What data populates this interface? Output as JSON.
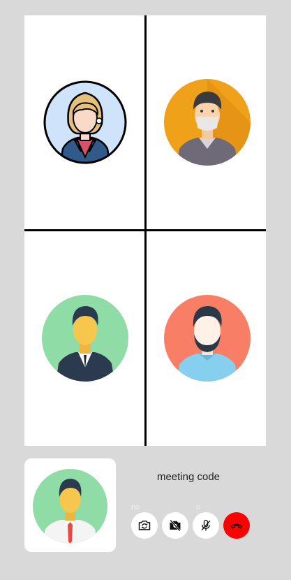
{
  "participants": [
    {
      "id": "participant-1",
      "avatar": "woman-blonde-avatar",
      "bg": "#cfe3fb"
    },
    {
      "id": "participant-2",
      "avatar": "man-mask-avatar",
      "bg": "#f0a11a"
    },
    {
      "id": "participant-3",
      "avatar": "man-suit-avatar",
      "bg": "#8fdca7"
    },
    {
      "id": "participant-4",
      "avatar": "man-beard-avatar",
      "bg": "#f87f66"
    }
  ],
  "self_view": {
    "avatar": "man-red-tie-avatar",
    "bg": "#8fdca7"
  },
  "meeting": {
    "code_label": "meeting code"
  },
  "ghost_labels": {
    "left": "no",
    "right": "o"
  },
  "controls": [
    {
      "name": "switch-camera-button",
      "icon": "camera-flip-icon"
    },
    {
      "name": "video-off-button",
      "icon": "video-off-icon"
    },
    {
      "name": "mute-button",
      "icon": "mic-off-icon"
    },
    {
      "name": "end-call-button",
      "icon": "phone-hangup-icon",
      "color": "#ff0000"
    }
  ]
}
